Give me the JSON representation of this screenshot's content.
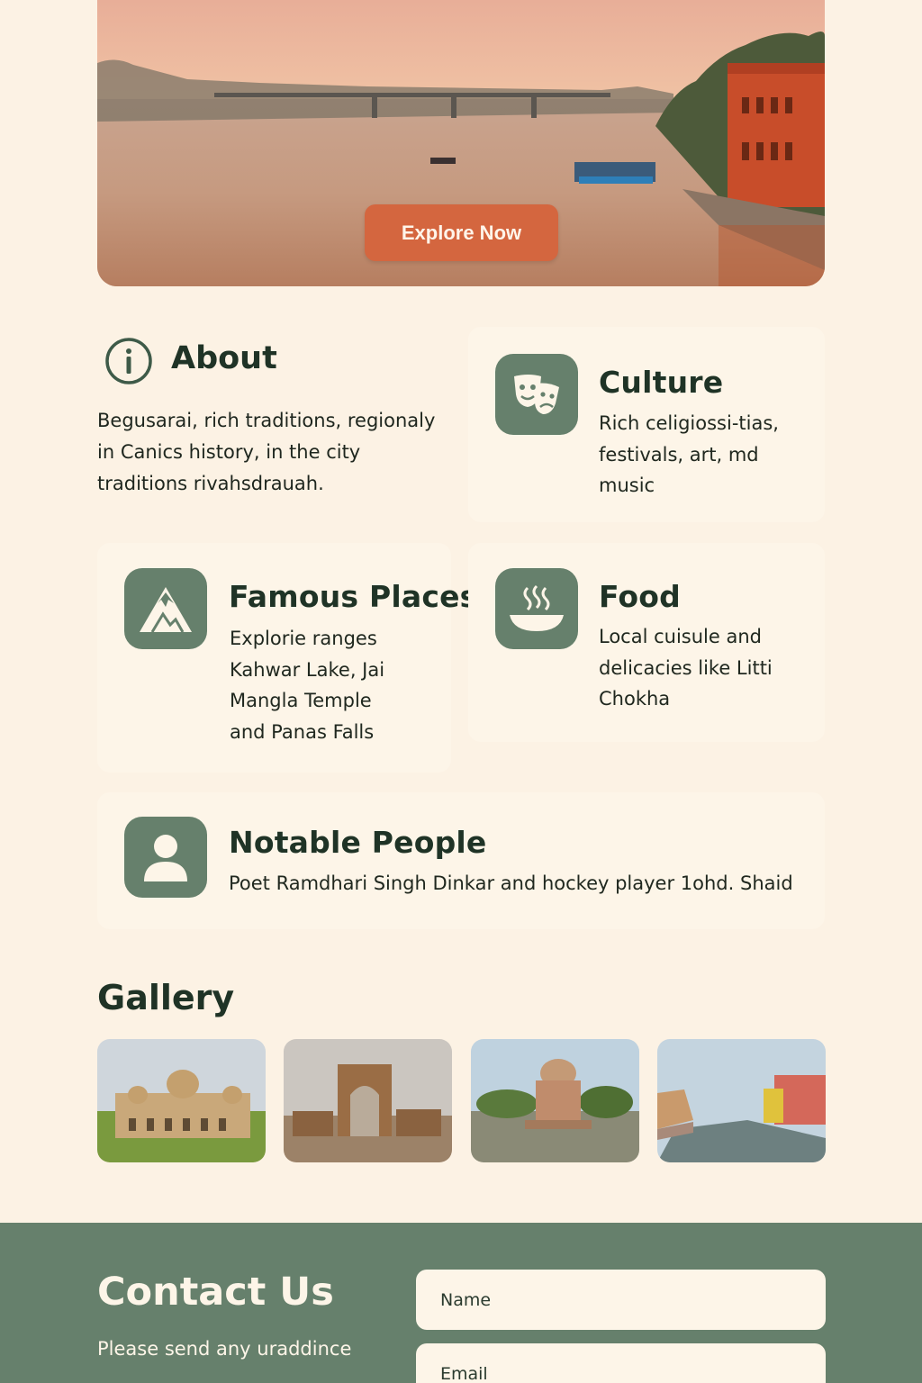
{
  "hero": {
    "button_label": "Explore Now"
  },
  "about": {
    "title": "About",
    "text": "Begusarai, rich traditions, regionaly in Canics history, in the city traditions rivahsdrauah."
  },
  "cards": {
    "culture": {
      "title": "Culture",
      "text": "Rich celigiossi-tias, festivals, art, md music",
      "icon": "theater-masks-icon"
    },
    "famous_places": {
      "title": "Famous Places",
      "text": "Explorie ranges Kahwar Lake, Jai Mangla Temple and Panas Falls",
      "icon": "mountain-icon"
    },
    "food": {
      "title": "Food",
      "text": "Local cuisule and delicacies like Litti Chokha",
      "icon": "steaming-bowl-icon"
    },
    "notable_people": {
      "title": "Notable People",
      "text": "Poet Ramdhari Singh Dinkar and hockey player 1ohd. Shaid",
      "icon": "person-icon"
    }
  },
  "gallery": {
    "title": "Gallery"
  },
  "contact": {
    "title": "Contact Us",
    "subtitle": "Please send any uraddince",
    "name_placeholder": "Name",
    "email_placeholder": "Email"
  },
  "colors": {
    "background": "#fcf2e4",
    "accent_button": "#d4663f",
    "icon_tile": "#66806c",
    "contact_band": "#66806c"
  }
}
